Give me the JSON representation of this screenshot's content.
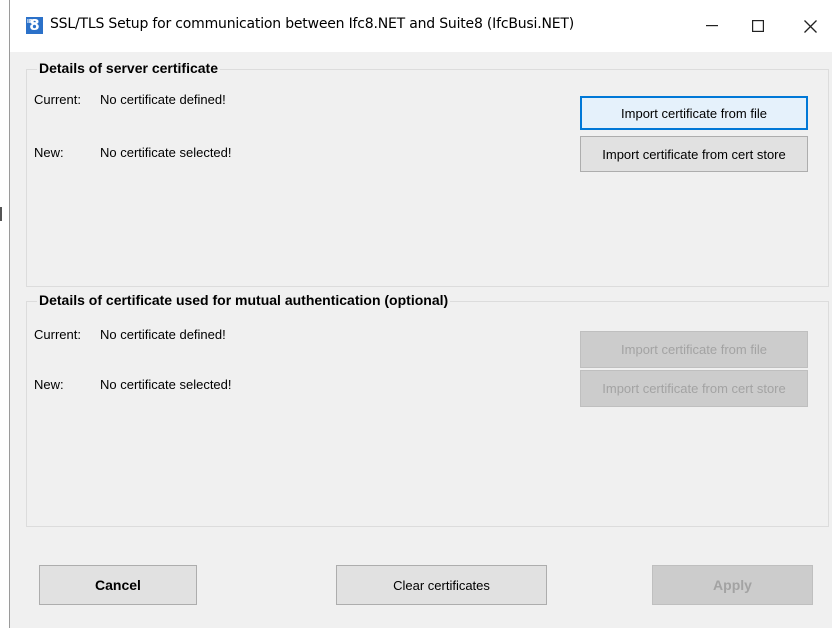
{
  "window": {
    "icon_glyph": "8",
    "icon_small": "IFC",
    "title": "SSL/TLS Setup for communication between Ifc8.NET and Suite8 (IfcBusi.NET)",
    "controls": {
      "minimize_icon": "minimize-icon",
      "maximize_icon": "maximize-icon",
      "close_icon": "close-icon"
    }
  },
  "server_group": {
    "title": "Details of server certificate",
    "current_label": "Current:",
    "current_value": "No certificate defined!",
    "new_label": "New:",
    "new_value": "No certificate selected!",
    "import_file_label": "Import certificate from file",
    "import_store_label": "Import certificate from cert store"
  },
  "mutual_group": {
    "title": "Details of certificate used for mutual authentication (optional)",
    "current_label": "Current:",
    "current_value": "No certificate defined!",
    "new_label": "New:",
    "new_value": "No certificate selected!",
    "import_file_label": "Import certificate from file",
    "import_store_label": "Import certificate from cert store"
  },
  "footer": {
    "cancel_label": "Cancel",
    "clear_label": "Clear certificates",
    "apply_label": "Apply"
  },
  "colors": {
    "accent": "#0078d7",
    "window_bg": "#f0f0f0",
    "disabled_text": "#a3a3a3"
  }
}
